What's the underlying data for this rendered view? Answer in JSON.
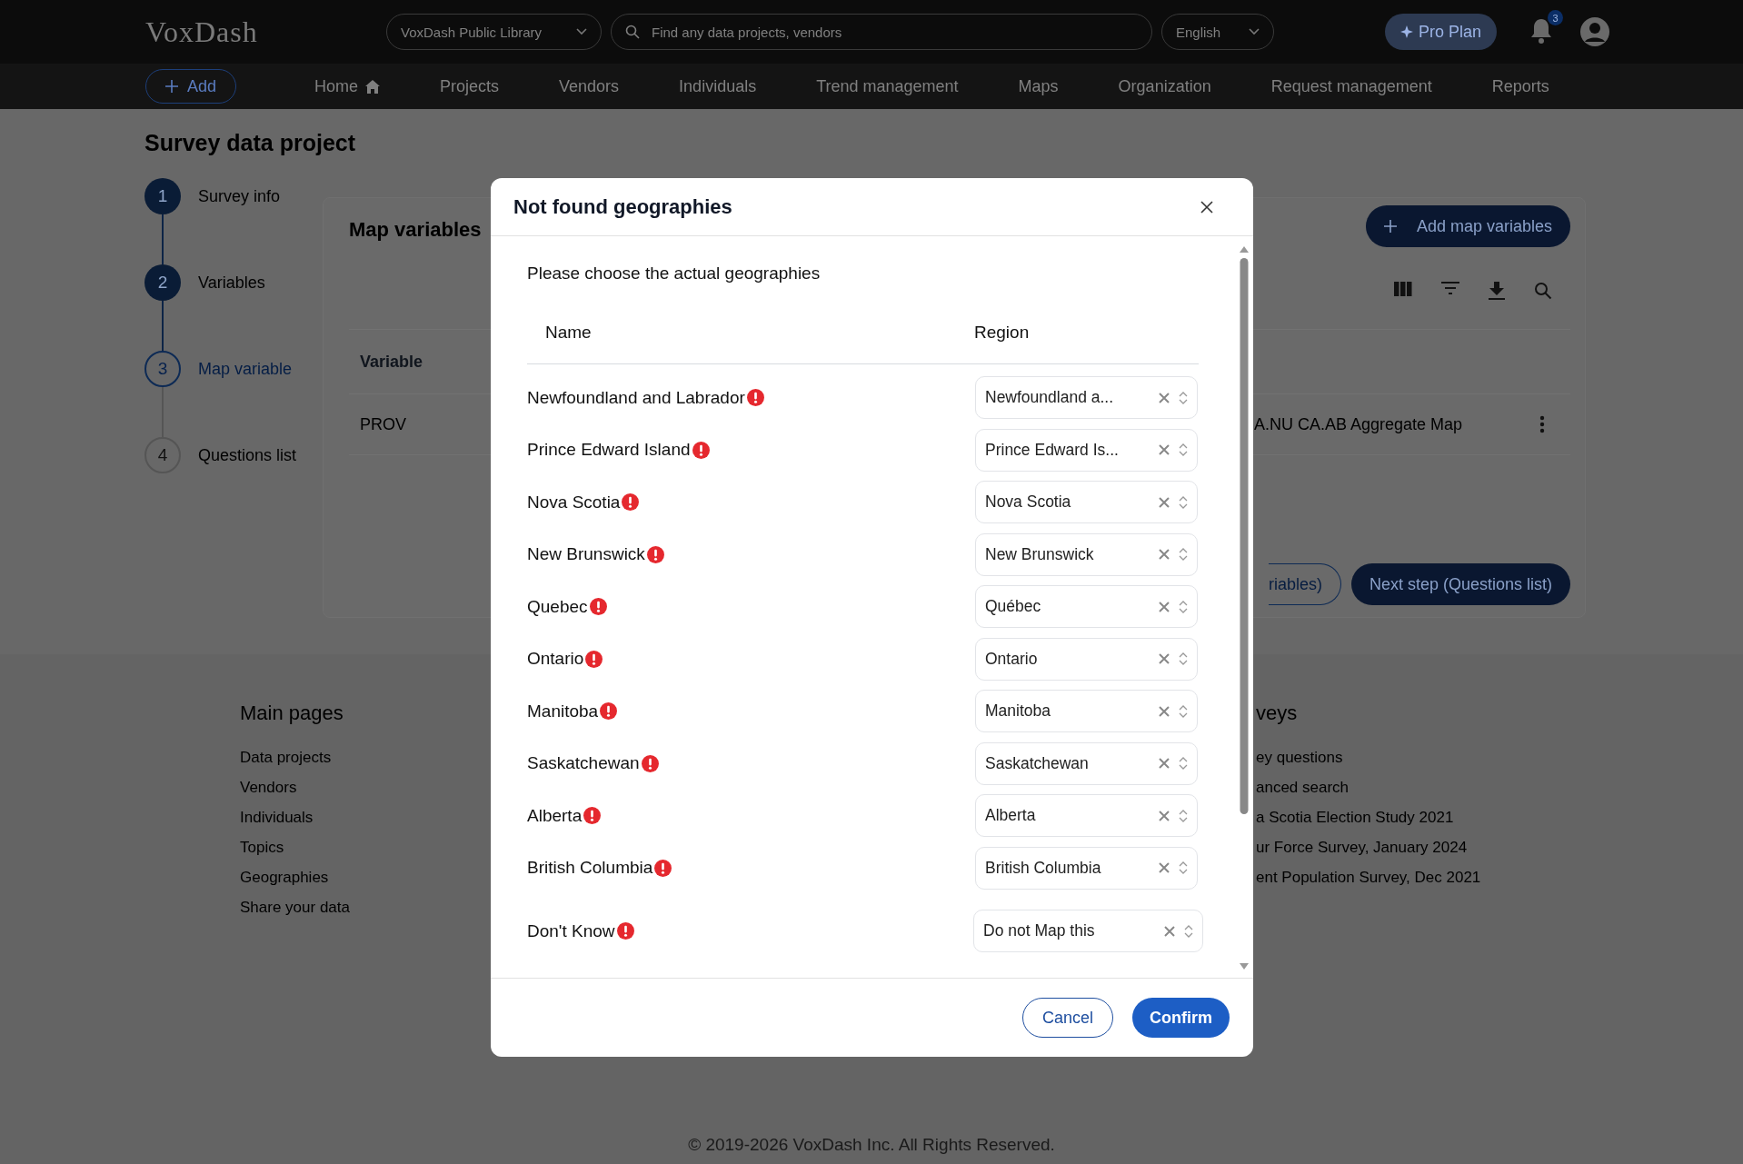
{
  "header": {
    "logo": "VoxDash",
    "library_select": "VoxDash Public Library",
    "search": {
      "placeholder": "Find any data projects, vendors"
    },
    "language": "English",
    "plan_button": "Pro Plan",
    "notifications": {
      "count": "3"
    }
  },
  "nav": {
    "add_button": "Add",
    "items": [
      {
        "label": "Home",
        "kind": "home"
      },
      {
        "label": "Projects",
        "kind": "plain"
      },
      {
        "label": "Vendors",
        "kind": "plain"
      },
      {
        "label": "Individuals",
        "kind": "plain"
      },
      {
        "label": "Trend management",
        "kind": "plain"
      },
      {
        "label": "Maps",
        "kind": "plain"
      },
      {
        "label": "Organization",
        "kind": "plain"
      },
      {
        "label": "Request management",
        "kind": "plain"
      },
      {
        "label": "Reports",
        "kind": "plain"
      }
    ]
  },
  "page": {
    "title": "Survey data project",
    "steps": [
      {
        "number": "1",
        "label": "Survey info",
        "completed": true,
        "selected": false
      },
      {
        "number": "2",
        "label": "Variables",
        "completed": true,
        "selected": false
      },
      {
        "number": "3",
        "label": "Map variable",
        "completed": false,
        "selected": true
      },
      {
        "number": "4",
        "label": "Questions list",
        "completed": false,
        "selected": false
      }
    ]
  },
  "card": {
    "title": "Map variables",
    "add_button": "Add map variables",
    "table": {
      "columns": [
        "Variable"
      ],
      "rows": [
        {
          "variable": "PROV",
          "column_2": "A.NU CA.AB Aggregate Map"
        }
      ]
    },
    "back_button": "riables)",
    "next_button": "Next step (Questions list)"
  },
  "footer": {
    "columns": [
      {
        "title": "Main pages",
        "links": [
          "Data projects",
          "Vendors",
          "Individuals",
          "Topics",
          "Geographies",
          "Share your data"
        ]
      },
      {
        "title": "veys",
        "links": [
          "ey questions",
          "anced search",
          "a Scotia Election Study 2021",
          "ur Force Survey, January 2024",
          "ent Population Survey, Dec 2021"
        ]
      }
    ],
    "copyright": "© 2019-2026 VoxDash Inc. All Rights Reserved."
  },
  "dialog": {
    "title": "Not found geographies",
    "instruction": "Please choose the actual geographies",
    "columns": [
      "Name",
      "Region"
    ],
    "rows": [
      {
        "name": "Newfoundland and Labrador",
        "warning": true,
        "region": "Newfoundland a..."
      },
      {
        "name": "Prince Edward Island",
        "warning": true,
        "region": "Prince Edward Is..."
      },
      {
        "name": "Nova Scotia",
        "warning": true,
        "region": "Nova Scotia"
      },
      {
        "name": "New Brunswick",
        "warning": true,
        "region": "New Brunswick"
      },
      {
        "name": "Quebec",
        "warning": true,
        "region": "Québec"
      },
      {
        "name": "Ontario",
        "warning": true,
        "region": "Ontario"
      },
      {
        "name": "Manitoba",
        "warning": true,
        "region": "Manitoba"
      },
      {
        "name": "Saskatchewan",
        "warning": true,
        "region": "Saskatchewan"
      },
      {
        "name": "Alberta",
        "warning": true,
        "region": "Alberta"
      },
      {
        "name": "British Columbia",
        "warning": true,
        "region": "British Columbia"
      },
      {
        "name": "Don't Know",
        "warning": true,
        "region": "Do not Map this"
      }
    ],
    "cancel_button": "Cancel",
    "confirm_button": "Confirm"
  }
}
